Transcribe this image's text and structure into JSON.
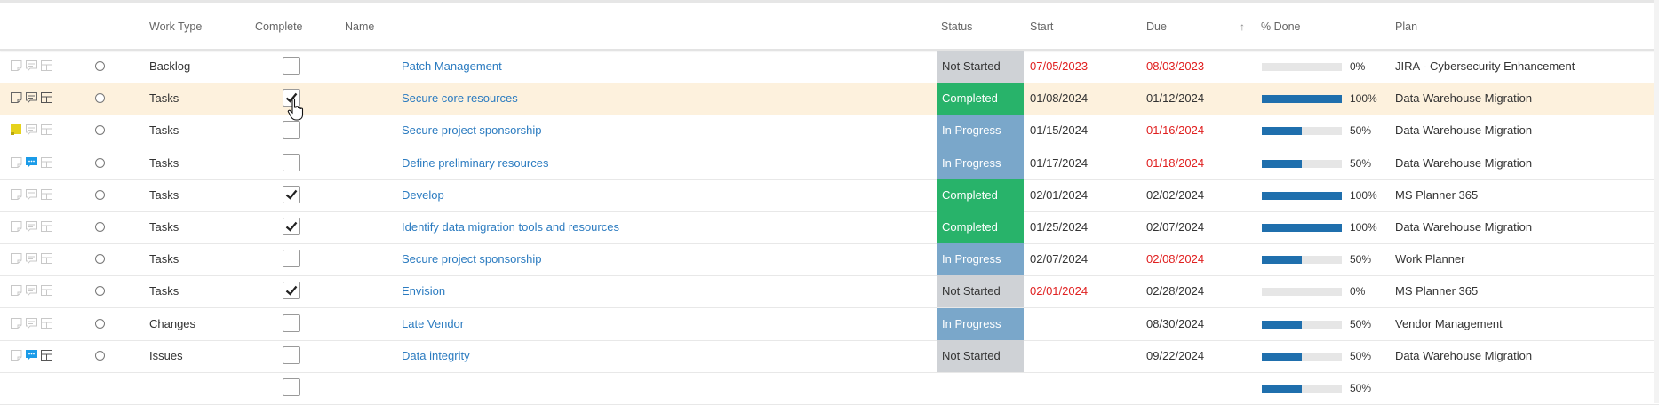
{
  "header": {
    "work_type": "Work Type",
    "complete": "Complete",
    "name": "Name",
    "status": "Status",
    "start": "Start",
    "due": "Due",
    "sort_icon": "↑",
    "pct_done": "% Done",
    "plan": "Plan"
  },
  "colors": {
    "accent_link": "#2b7bc0",
    "completed": "#28b36a",
    "in_progress": "#7aa7ca",
    "not_started": "#cfd2d6",
    "overdue": "#e02020",
    "progress_fill": "#1f6fad",
    "selected_row": "#fdf1dd"
  },
  "rows": [
    {
      "work_type": "Backlog",
      "complete": false,
      "name": "Patch Management",
      "status": "Not Started",
      "start": "07/05/2023",
      "start_red": true,
      "due": "08/03/2023",
      "due_red": true,
      "pct": 0,
      "pct_label": "0%",
      "plan": "JIRA - Cybersecurity Enhancement",
      "selected": false,
      "icons": [
        "note-icon",
        "comment-icon",
        "board-icon"
      ],
      "icon_active": []
    },
    {
      "work_type": "Tasks",
      "complete": true,
      "name": "Secure core resources",
      "status": "Completed",
      "start": "01/08/2024",
      "start_red": false,
      "due": "01/12/2024",
      "due_red": false,
      "pct": 1,
      "pct_label": "100%",
      "plan": "Data Warehouse Migration",
      "selected": true,
      "icons": [
        "note-icon",
        "comment-icon",
        "board-icon"
      ],
      "icon_active": [
        "note-icon",
        "comment-icon",
        "board-icon"
      ]
    },
    {
      "work_type": "Tasks",
      "complete": false,
      "name": "Secure project sponsorship",
      "status": "In Progress",
      "start": "01/15/2024",
      "start_red": false,
      "due": "01/16/2024",
      "due_red": true,
      "pct": 0.5,
      "pct_label": "50%",
      "plan": "Data Warehouse Migration",
      "selected": false,
      "icons": [
        "note-icon",
        "comment-icon",
        "board-icon"
      ],
      "icon_active": [
        "note-icon-yellow"
      ]
    },
    {
      "work_type": "Tasks",
      "complete": false,
      "name": "Define preliminary resources",
      "status": "In Progress",
      "start": "01/17/2024",
      "start_red": false,
      "due": "01/18/2024",
      "due_red": true,
      "pct": 0.5,
      "pct_label": "50%",
      "plan": "Data Warehouse Migration",
      "selected": false,
      "icons": [
        "note-icon",
        "comment-icon",
        "board-icon"
      ],
      "icon_active": [
        "comment-icon-blue"
      ]
    },
    {
      "work_type": "Tasks",
      "complete": true,
      "name": "Develop",
      "status": "Completed",
      "start": "02/01/2024",
      "start_red": false,
      "due": "02/02/2024",
      "due_red": false,
      "pct": 1,
      "pct_label": "100%",
      "plan": "MS Planner 365",
      "selected": false,
      "icons": [
        "note-icon",
        "comment-icon",
        "board-icon"
      ],
      "icon_active": []
    },
    {
      "work_type": "Tasks",
      "complete": true,
      "name": "Identify data migration tools and resources",
      "status": "Completed",
      "start": "01/25/2024",
      "start_red": false,
      "due": "02/07/2024",
      "due_red": false,
      "pct": 1,
      "pct_label": "100%",
      "plan": "Data Warehouse Migration",
      "selected": false,
      "icons": [
        "note-icon",
        "comment-icon",
        "board-icon"
      ],
      "icon_active": []
    },
    {
      "work_type": "Tasks",
      "complete": false,
      "name": "Secure project sponsorship",
      "status": "In Progress",
      "start": "02/07/2024",
      "start_red": false,
      "due": "02/08/2024",
      "due_red": true,
      "pct": 0.5,
      "pct_label": "50%",
      "plan": "Work Planner",
      "selected": false,
      "icons": [
        "note-icon",
        "comment-icon",
        "board-icon"
      ],
      "icon_active": []
    },
    {
      "work_type": "Tasks",
      "complete": true,
      "name": "Envision",
      "status": "Not Started",
      "start": "02/01/2024",
      "start_red": true,
      "due": "02/28/2024",
      "due_red": false,
      "pct": 0,
      "pct_label": "0%",
      "plan": "MS Planner 365",
      "selected": false,
      "icons": [
        "note-icon",
        "comment-icon",
        "board-icon"
      ],
      "icon_active": []
    },
    {
      "work_type": "Changes",
      "complete": false,
      "name": "Late Vendor",
      "status": "In Progress",
      "start": "",
      "start_red": false,
      "due": "08/30/2024",
      "due_red": false,
      "pct": 0.5,
      "pct_label": "50%",
      "plan": "Vendor Management",
      "selected": false,
      "icons": [
        "note-icon",
        "comment-icon",
        "board-icon"
      ],
      "icon_active": []
    },
    {
      "work_type": "Issues",
      "complete": false,
      "name": "Data integrity",
      "status": "Not Started",
      "start": "",
      "start_red": false,
      "due": "09/22/2024",
      "due_red": false,
      "pct": 0.5,
      "pct_label": "50%",
      "plan": "Data Warehouse Migration",
      "selected": false,
      "icons": [
        "note-icon",
        "comment-icon",
        "board-icon"
      ],
      "icon_active": [
        "comment-icon-blue",
        "board-icon"
      ]
    }
  ],
  "summary_row": {
    "complete": false,
    "pct": 0.5,
    "pct_label": "50%"
  }
}
